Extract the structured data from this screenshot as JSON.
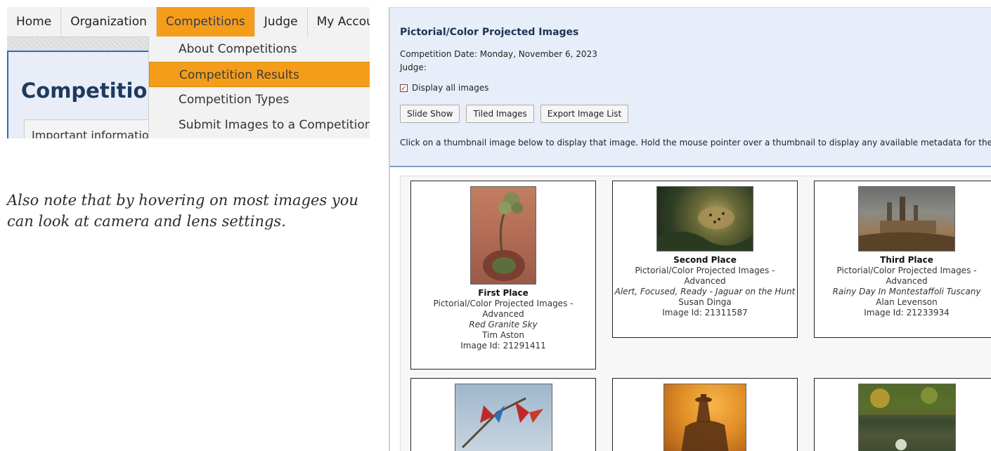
{
  "nav": {
    "items": [
      "Home",
      "Organization",
      "Competitions",
      "Judge",
      "My Account"
    ],
    "active_index": 2
  },
  "dropdown": {
    "items": [
      "About Competitions",
      "Competition Results",
      "Competition Types",
      "Submit Images to a Competition"
    ],
    "active_index": 1
  },
  "left_page": {
    "heading": "Competition",
    "info_box": "Important information"
  },
  "hover_note": "Also note that by hovering on most images you can look at camera and lens settings.",
  "competition": {
    "title": "Pictorial/Color Projected Images",
    "date_line": "Competition Date: Monday, November 6, 2023",
    "judge_line": "Judge:",
    "display_all_label": "Display all images",
    "display_all_checked": true,
    "buttons": [
      "Slide Show",
      "Tiled Images",
      "Export Image List"
    ],
    "instructions": "Click on a thumbnail image below to display that image. Hold the mouse pointer over a thumbnail to display any available metadata for the image."
  },
  "gallery": [
    {
      "place": "First Place",
      "category": "Pictorial/Color Projected Images - Advanced",
      "image_title": "Red Granite Sky",
      "author": "Tim Aston",
      "image_id": "Image Id: 21291411"
    },
    {
      "place": "Second Place",
      "category": "Pictorial/Color Projected Images - Advanced",
      "image_title": "Alert, Focused, Ready - Jaguar on the Hunt",
      "author": "Susan Dinga",
      "image_id": "Image Id: 21311587"
    },
    {
      "place": "Third Place",
      "category": "Pictorial/Color Projected Images - Advanced",
      "image_title": "Rainy Day In Montestaffoli Tuscany",
      "author": "Alan Levenson",
      "image_id": "Image Id: 21233934"
    },
    {
      "place": "",
      "category": "",
      "image_title": "",
      "author": "",
      "image_id": ""
    },
    {
      "place": "",
      "category": "",
      "image_title": "",
      "author": "",
      "image_id": ""
    },
    {
      "place": "",
      "category": "",
      "image_title": "",
      "author": "",
      "image_id": ""
    }
  ],
  "colors": {
    "nav_active": "#f59d1b",
    "heading_blue": "#1e3a5c",
    "panel_bg": "#e8eef9"
  }
}
